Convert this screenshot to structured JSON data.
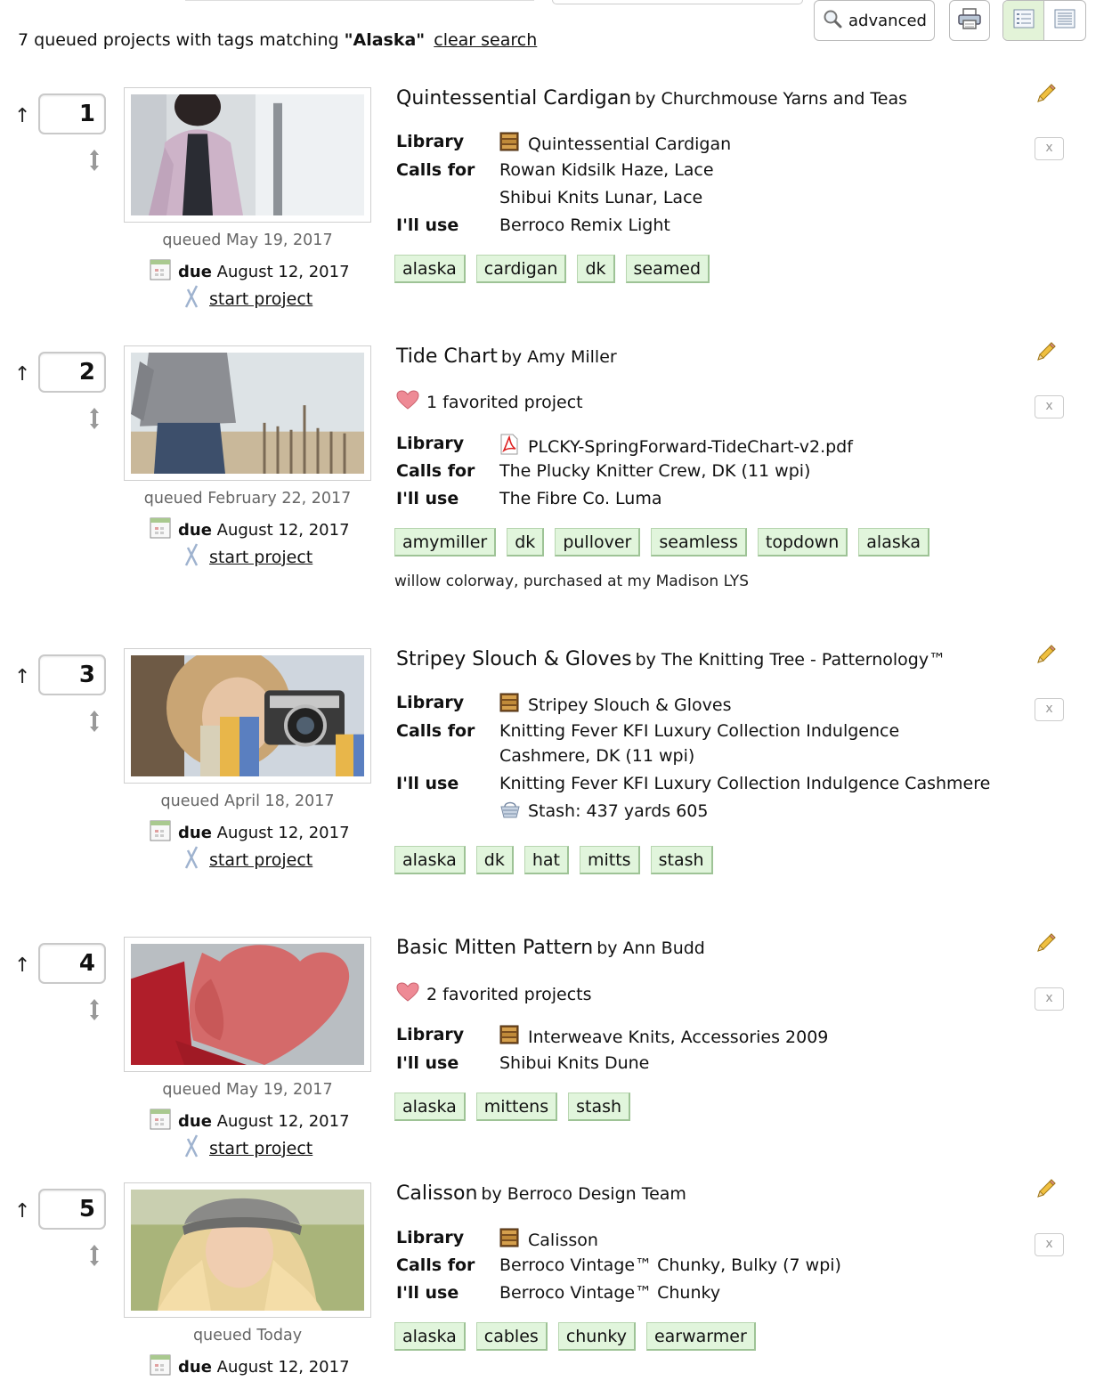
{
  "toolbar": {
    "advanced_label": "advanced"
  },
  "summary": {
    "prefix": "7 queued projects with tags matching ",
    "query": "\"Alaska\"",
    "clear_label": "clear search"
  },
  "items": [
    {
      "position": "1",
      "title": "Quintessential Cardigan",
      "by": "by Churchmouse Yarns and Teas",
      "library_label": "Library",
      "library": "Quintessential Cardigan",
      "library_icon": "book-shelf-icon",
      "calls_for_label": "Calls for",
      "calls_for": [
        "Rowan Kidsilk Haze, Lace",
        "Shibui Knits Lunar, Lace"
      ],
      "ill_use_label": "I'll use",
      "ill_use": "Berroco Remix Light",
      "tags": [
        "alaska",
        "cardigan",
        "dk",
        "seamed"
      ],
      "queued": "queued May 19, 2017",
      "due_label": "due",
      "due": "August 12, 2017",
      "start_label": "start project"
    },
    {
      "position": "2",
      "title": "Tide Chart",
      "by": "by Amy Miller",
      "favorites": "1 favorited project",
      "library_label": "Library",
      "library": "PLCKY-SpringForward-TideChart-v2.pdf",
      "library_icon": "pdf-icon",
      "calls_for_label": "Calls for",
      "calls_for": [
        "The Plucky Knitter Crew, DK (11 wpi)"
      ],
      "ill_use_label": "I'll use",
      "ill_use": "The Fibre Co. Luma",
      "tags": [
        "amymiller",
        "dk",
        "pullover",
        "seamless",
        "topdown",
        "alaska"
      ],
      "notes": "willow colorway, purchased at my Madison LYS",
      "queued": "queued February 22, 2017",
      "due_label": "due",
      "due": "August 12, 2017",
      "start_label": "start project"
    },
    {
      "position": "3",
      "title": "Stripey Slouch & Gloves",
      "by": "by The Knitting Tree - Patternology™",
      "library_label": "Library",
      "library": "Stripey Slouch & Gloves",
      "library_icon": "book-shelf-icon",
      "calls_for_label": "Calls for",
      "calls_for": [
        "Knitting Fever KFI Luxury Collection Indulgence",
        "Cashmere, DK (11 wpi)"
      ],
      "ill_use_label": "I'll use",
      "ill_use": "Knitting Fever KFI Luxury Collection Indulgence Cashmere",
      "stash": "Stash: 437 yards 605",
      "tags": [
        "alaska",
        "dk",
        "hat",
        "mitts",
        "stash"
      ],
      "queued": "queued April 18, 2017",
      "due_label": "due",
      "due": "August 12, 2017",
      "start_label": "start project"
    },
    {
      "position": "4",
      "title": "Basic Mitten Pattern",
      "by": "by Ann Budd",
      "favorites": "2 favorited projects",
      "library_label": "Library",
      "library": "Interweave Knits, Accessories 2009",
      "library_icon": "book-shelf-icon",
      "ill_use_label": "I'll use",
      "ill_use": "Shibui Knits Dune",
      "tags": [
        "alaska",
        "mittens",
        "stash"
      ],
      "queued": "queued May 19, 2017",
      "due_label": "due",
      "due": "August 12, 2017",
      "start_label": "start project"
    },
    {
      "position": "5",
      "title": "Calisson",
      "by": "by Berroco Design Team",
      "library_label": "Library",
      "library": "Calisson",
      "library_icon": "book-shelf-icon",
      "calls_for_label": "Calls for",
      "calls_for": [
        "Berroco Vintage™ Chunky, Bulky (7 wpi)"
      ],
      "ill_use_label": "I'll use",
      "ill_use": "Berroco Vintage™ Chunky",
      "tags": [
        "alaska",
        "cables",
        "chunky",
        "earwarmer"
      ],
      "queued": "queued Today",
      "due_label": "due",
      "due": "August 12, 2017"
    }
  ],
  "colors": {
    "tag_bg": "#e1f5dc",
    "tag_border": "#9ec396",
    "active_view_bg": "#e3f3d8"
  }
}
